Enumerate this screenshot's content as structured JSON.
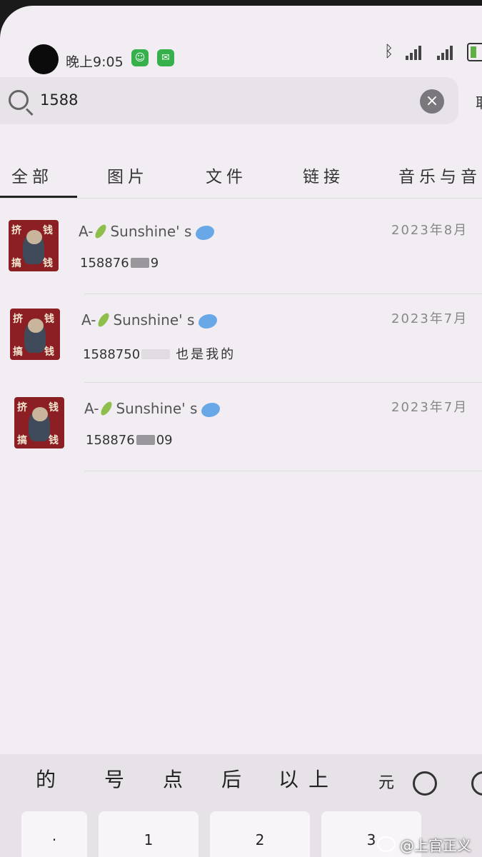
{
  "status_bar": {
    "time": "晚上9:05",
    "app_icons": [
      "green-app-icon",
      "wechat-icon"
    ],
    "bluetooth": "bluetooth-icon",
    "battery_color": "#5fb043"
  },
  "search": {
    "query": "1588",
    "clear_icon": "close-icon",
    "cancel_label": "取"
  },
  "tabs": [
    {
      "label": "全部",
      "active": true
    },
    {
      "label": "图片"
    },
    {
      "label": "文件"
    },
    {
      "label": "链接"
    },
    {
      "label": "音乐与音"
    }
  ],
  "results": [
    {
      "sender": "A-",
      "sender_suffix": "Sunshine' s",
      "date": "2023年8月",
      "snippet_a": "158876",
      "snippet_b": "9",
      "snippet_tail": ""
    },
    {
      "sender": "A-",
      "sender_suffix": "Sunshine' s",
      "date": "2023年7月",
      "snippet_a": "1588750",
      "snippet_b": "",
      "snippet_tail": "也是我的"
    },
    {
      "sender": "A-",
      "sender_suffix": "Sunshine' s",
      "date": "2023年7月",
      "snippet_a": "158876",
      "snippet_b": "09",
      "snippet_tail": ""
    }
  ],
  "avatar_text": {
    "top": "挤",
    "right": "钱",
    "bottom_left": "搞",
    "bottom_right": "钱"
  },
  "keyboard": {
    "candidates": [
      "的",
      "号",
      "点",
      "后",
      "以上",
      "元"
    ],
    "keys": [
      "·",
      "1",
      "2",
      "3"
    ]
  },
  "watermark": "@上官正义"
}
